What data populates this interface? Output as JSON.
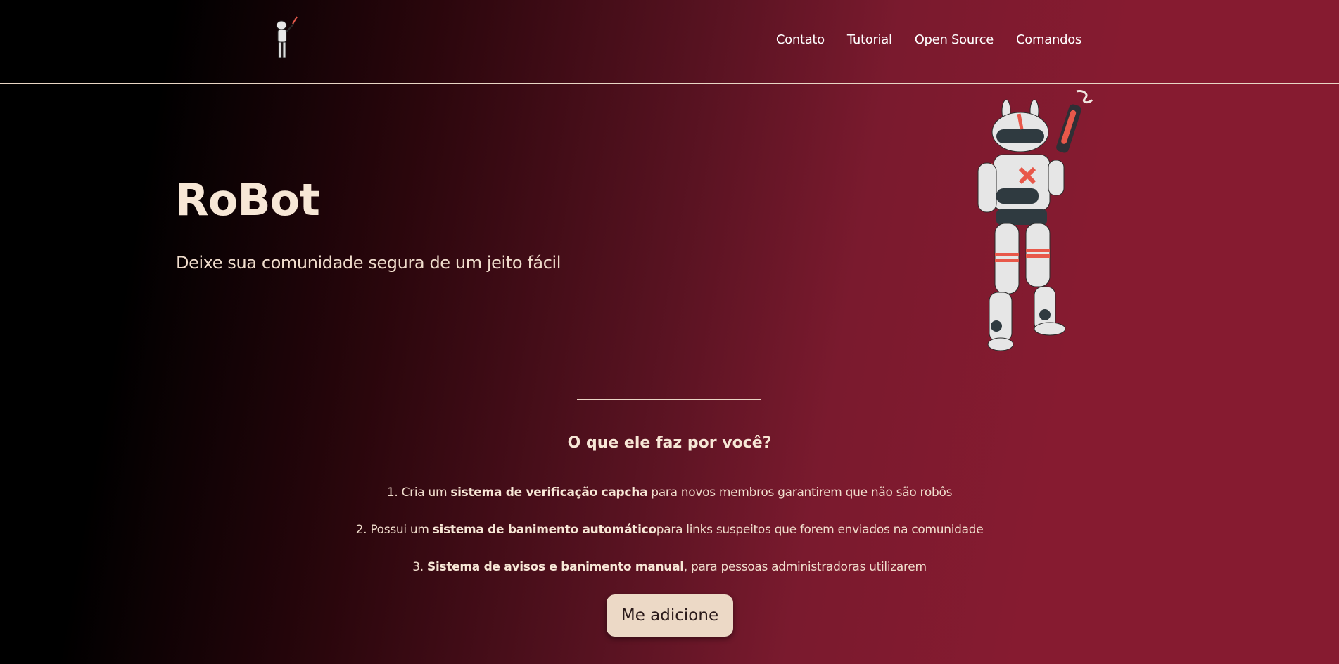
{
  "nav": {
    "items": [
      {
        "label": "Contato"
      },
      {
        "label": "Tutorial"
      },
      {
        "label": "Open Source"
      },
      {
        "label": "Comandos"
      }
    ]
  },
  "hero": {
    "title": "RoBot",
    "subtitle": "Deixe sua comunidade segura de um jeito fácil"
  },
  "features": {
    "title": "O que ele faz por você?",
    "items": [
      {
        "prefix": "1. Cria um ",
        "bold": "sistema de verificação capcha",
        "suffix": " para novos membros garantirem que não são robôs"
      },
      {
        "prefix": "2. Possui um ",
        "bold": "sistema de banimento automático",
        "suffix": "para links suspeitos que forem enviados na comunidade"
      },
      {
        "prefix": "3. ",
        "bold": "Sistema de avisos e banimento manual",
        "suffix": ", para pessoas administradoras utilizarem"
      }
    ]
  },
  "cta": {
    "label": "Me adicione"
  },
  "colors": {
    "accent": "#861b30",
    "text": "#f7e7d6",
    "button": "#ecd9c6"
  },
  "icons": {
    "logo": "robot-logo-icon",
    "illustration": "robot-illustration"
  }
}
